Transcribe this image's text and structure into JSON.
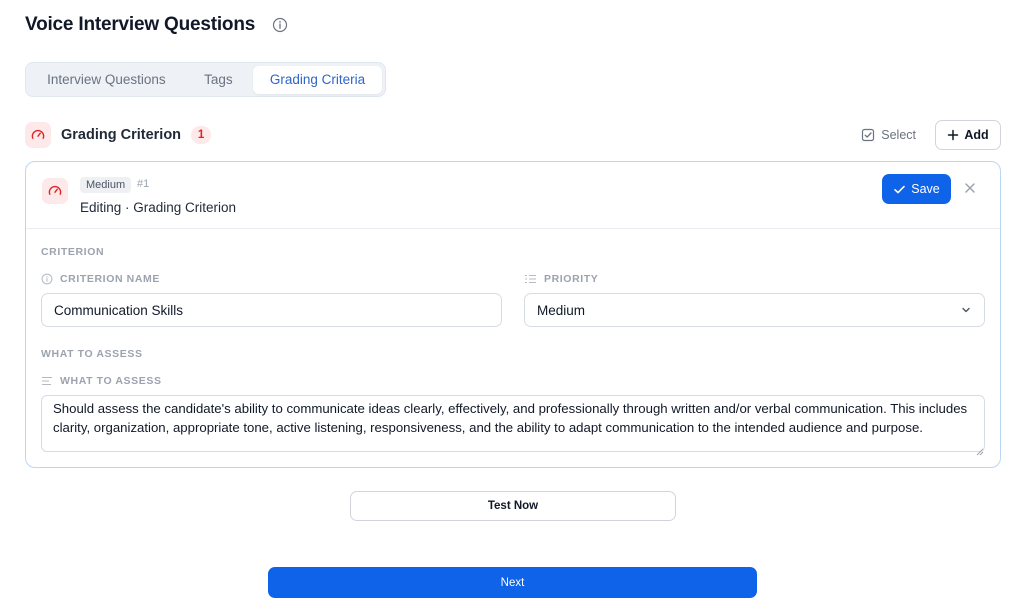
{
  "page": {
    "title": "Voice Interview Questions"
  },
  "tabs": [
    {
      "label": "Interview Questions"
    },
    {
      "label": "Tags"
    },
    {
      "label": "Grading Criteria"
    }
  ],
  "section": {
    "title": "Grading Criterion",
    "count": "1",
    "select_label": "Select",
    "add_label": "Add"
  },
  "card": {
    "level_badge": "Medium",
    "number": "#1",
    "editing_text": "Editing · Grading Criterion",
    "save_label": "Save",
    "criterion_group": "CRITERION",
    "criterion_name_label": "CRITERION NAME",
    "criterion_name_value": "Communication Skills",
    "priority_label": "PRIORITY",
    "priority_value": "Medium",
    "assess_group": "WHAT TO ASSESS",
    "assess_label": "WHAT TO ASSESS",
    "assess_value": "Should assess the candidate's ability to communicate ideas clearly, effectively, and professionally through written and/or verbal communication. This includes clarity, organization, appropriate tone, active listening, responsiveness, and the ability to adapt communication to the intended audience and purpose."
  },
  "actions": {
    "test_label": "Test Now",
    "next_label": "Next"
  },
  "colors": {
    "primary": "#0f63e8",
    "active_tab_text": "#2f66c9",
    "danger": "#dc2626",
    "danger_bg": "#fde8ea",
    "card_border": "#bcd6f5"
  },
  "icons": {
    "title_info": "info-icon",
    "criterion": "gauge-icon",
    "select": "checkbox-icon",
    "add": "plus-icon",
    "save": "check-icon",
    "close": "close-icon",
    "name_field": "info-circle-icon",
    "priority_field": "list-priority-icon",
    "assess_field": "text-lines-icon",
    "priority_dropdown": "chevron-down-icon"
  }
}
